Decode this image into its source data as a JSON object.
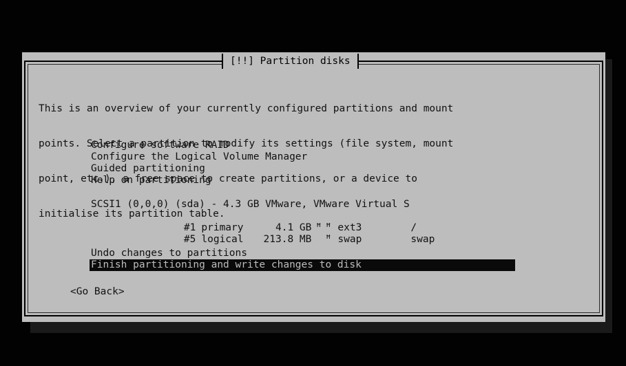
{
  "dialog": {
    "title": "[!!] Partition disks",
    "intro": [
      "This is an overview of your currently configured partitions and mount",
      "points. Select a partition to modify its settings (file system, mount",
      "point, etc.), a free space to create partitions, or a device to",
      "initialise its partition table."
    ],
    "menu": [
      "Configure software RAID",
      "Configure the Logical Volume Manager",
      "Guided partitioning",
      "Help on partitioning"
    ],
    "disk": {
      "label": "SCSI1 (0,0,0) (sda) - 4.3 GB VMware, VMware Virtual S",
      "partitions": [
        {
          "number": "#1",
          "type": "primary",
          "size": "4.1 GB",
          "flag": "ꟸ",
          "fs_icon": "ꟸ",
          "fs": "ext3",
          "mount": "/"
        },
        {
          "number": "#5",
          "type": "logical",
          "size": "213.8 MB",
          "flag": "",
          "fs_icon": "ꟸ",
          "fs": "swap",
          "mount": "swap"
        }
      ]
    },
    "actions": [
      "Undo changes to partitions",
      "Finish partitioning and write changes to disk"
    ],
    "go_back": "<Go Back>"
  }
}
